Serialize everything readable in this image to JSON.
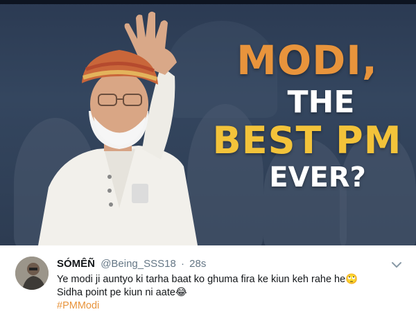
{
  "banner": {
    "headline": {
      "line1": "MODI,",
      "line2": "THE",
      "line3": "BEST PM",
      "line4": "EVER?"
    },
    "colors": {
      "line1": "#e8943c",
      "line2": "#ffffff",
      "line3": "#f3c33a",
      "line4": "#ffffff",
      "background": "#2d3c52"
    }
  },
  "tweet": {
    "display_name": "SÓMÊÑ",
    "handle": "@Being_SSS18",
    "separator": "·",
    "time": "28s",
    "text_line1": "Ye modi ji auntyo ki tarha baat ko ghuma fira ke kiun keh rahe he🙄",
    "text_line2": "Sidha point pe kiun ni aate😂",
    "hashtag": "#PMModi",
    "icons": {
      "menu": "chevron-down-icon",
      "avatar": "avatar"
    }
  }
}
